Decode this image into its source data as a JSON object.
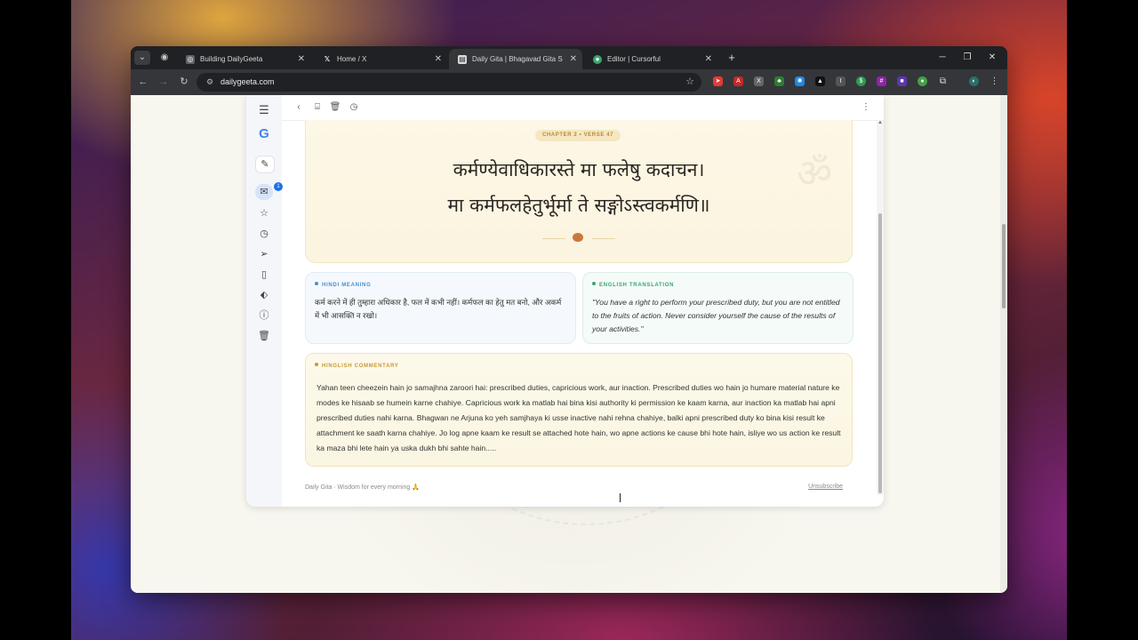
{
  "tabs": [
    {
      "title": "Building DailyGeeta",
      "icon": "tab-favicon-building",
      "active": false
    },
    {
      "title": "Home / X",
      "icon": "x-logo-icon",
      "active": false
    },
    {
      "title": "Daily Gita | Bhagavad Gita Shlok",
      "icon": "tab-favicon-dailygita",
      "active": true
    },
    {
      "title": "Editor | Cursorful",
      "icon": "cursorful-icon",
      "active": false
    }
  ],
  "address_bar": {
    "url": "dailygeeta.com"
  },
  "mail": {
    "inbox_badge": "1"
  },
  "verse": {
    "chip": "CHAPTER 2 • VERSE 47",
    "line1": "कर्मण्येवाधिकारस्ते मा फलेषु कदाचन।",
    "line2": "मा कर्मफलहेतुर्भूर्मा ते सङ्गोऽस्त्वकर्मणि॥",
    "om": "ॐ"
  },
  "hindi": {
    "label": "HINDI MEANING",
    "text": "कर्म करने में ही तुम्हारा अधिकार है, फल में कभी नहीं। कर्मफल का हेतु मत बनो, और अकर्म में भी आसक्ति न रखो।"
  },
  "english": {
    "label": "ENGLISH TRANSLATION",
    "text": "\"You have a right to perform your prescribed duty, but you are not entitled to the fruits of action. Never consider yourself the cause of the results of your activities.\""
  },
  "commentary": {
    "label": "HINGLISH COMMENTARY",
    "text": "Yahan teen cheezein hain jo samajhna zaroori hai: prescribed duties, capricious work, aur inaction. Prescribed duties wo hain jo humare material nature ke modes ke hisaab se humein karne chahiye. Capricious work ka matlab hai bina kisi authority ki permission ke kaam karna, aur inaction ka matlab hai apni prescribed duties nahi karna. Bhagwan ne Arjuna ko yeh samjhaya ki usse inactive nahi rehna chahiye, balki apni prescribed duty ko bina kisi result ke attachment ke saath karna chahiye. Jo log apne kaam ke result se attached hote hain, wo apne actions ke cause bhi hote hain, isliye wo us action ke result ka maza bhi lete hain ya uska dukh bhi sahte hain....."
  },
  "footer": {
    "left": "Daily Gita · Wisdom for every morning 🙏",
    "right": "Unsubscribe"
  },
  "colors": {
    "accent_gold": "#b6893a",
    "hindi_label": "#4a8fc9",
    "english_label": "#3aa672",
    "commentary_label": "#c49a3a"
  }
}
